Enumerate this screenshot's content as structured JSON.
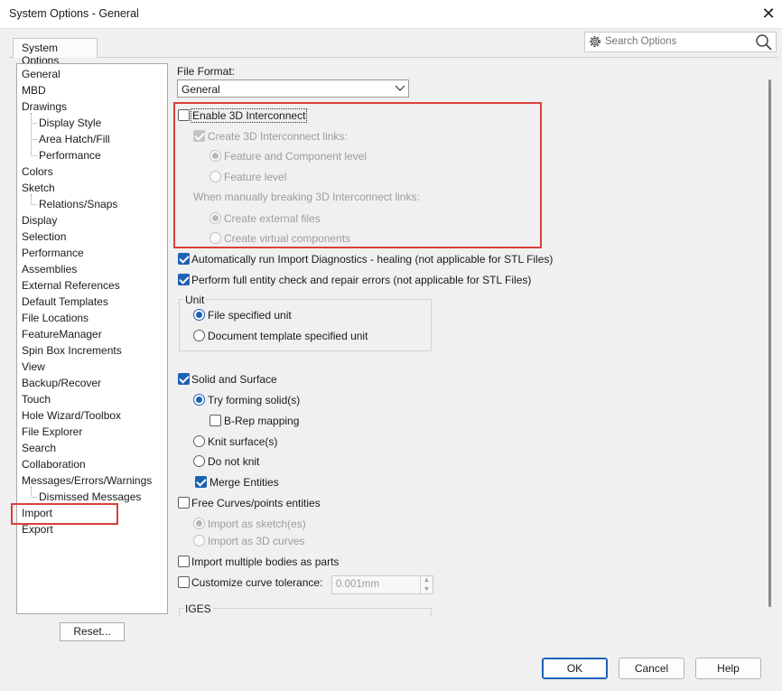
{
  "window": {
    "title": "System Options - General",
    "close_glyph": "✕"
  },
  "tab": {
    "label": "System Options"
  },
  "search": {
    "placeholder": "Search Options",
    "gear_icon": "gear-icon",
    "search_icon": "magnifier-icon"
  },
  "tree": {
    "items": [
      {
        "label": "General",
        "level": 0
      },
      {
        "label": "MBD",
        "level": 0
      },
      {
        "label": "Drawings",
        "level": 0
      },
      {
        "label": "Display Style",
        "level": 1
      },
      {
        "label": "Area Hatch/Fill",
        "level": 1
      },
      {
        "label": "Performance",
        "level": 1
      },
      {
        "label": "Colors",
        "level": 0
      },
      {
        "label": "Sketch",
        "level": 0
      },
      {
        "label": "Relations/Snaps",
        "level": 1
      },
      {
        "label": "Display",
        "level": 0
      },
      {
        "label": "Selection",
        "level": 0
      },
      {
        "label": "Performance",
        "level": 0
      },
      {
        "label": "Assemblies",
        "level": 0
      },
      {
        "label": "External References",
        "level": 0
      },
      {
        "label": "Default Templates",
        "level": 0
      },
      {
        "label": "File Locations",
        "level": 0
      },
      {
        "label": "FeatureManager",
        "level": 0
      },
      {
        "label": "Spin Box Increments",
        "level": 0
      },
      {
        "label": "View",
        "level": 0
      },
      {
        "label": "Backup/Recover",
        "level": 0
      },
      {
        "label": "Touch",
        "level": 0
      },
      {
        "label": "Hole Wizard/Toolbox",
        "level": 0
      },
      {
        "label": "File Explorer",
        "level": 0
      },
      {
        "label": "Search",
        "level": 0
      },
      {
        "label": "Collaboration",
        "level": 0
      },
      {
        "label": "Messages/Errors/Warnings",
        "level": 0
      },
      {
        "label": "Dismissed Messages",
        "level": 1
      },
      {
        "label": "Import",
        "level": 0,
        "selected": true
      },
      {
        "label": "Export",
        "level": 0
      }
    ],
    "reset_label": "Reset..."
  },
  "main": {
    "file_format_label": "File Format:",
    "file_format_value": "General",
    "enable_3d_interconnect": {
      "label": "Enable 3D Interconnect",
      "checked": false
    },
    "create_links": {
      "label": "Create 3D Interconnect links:",
      "checked": true,
      "disabled": true
    },
    "feature_component_level": {
      "label": "Feature and Component level",
      "selected": true
    },
    "feature_level": {
      "label": "Feature level",
      "selected": false
    },
    "breaking_links_label": "When manually breaking 3D Interconnect links:",
    "create_external_files": {
      "label": "Create external files",
      "selected": true
    },
    "create_virtual_components": {
      "label": "Create virtual components",
      "selected": false
    },
    "auto_import_diagnostics": {
      "label": "Automatically run Import Diagnostics - healing (not applicable for STL Files)",
      "checked": true
    },
    "full_entity_check": {
      "label": "Perform full entity check and repair errors (not applicable for STL Files)",
      "checked": true
    },
    "unit_group": {
      "title": "Unit",
      "file_specified_unit": {
        "label": "File specified unit",
        "selected": true
      },
      "document_template_unit": {
        "label": "Document template specified unit",
        "selected": false
      }
    },
    "solid_and_surface": {
      "label": "Solid and Surface",
      "checked": true
    },
    "try_forming_solids": {
      "label": "Try forming solid(s)",
      "selected": true
    },
    "brep_mapping": {
      "label": "B-Rep mapping",
      "checked": false
    },
    "knit_surfaces": {
      "label": "Knit surface(s)",
      "selected": false
    },
    "do_not_knit": {
      "label": "Do not knit",
      "selected": false
    },
    "merge_entities": {
      "label": "Merge Entities",
      "checked": true
    },
    "free_curves": {
      "label": "Free Curves/points entities",
      "checked": false
    },
    "import_as_sketch": {
      "label": "Import as sketch(es)",
      "selected": true
    },
    "import_as_3d_curves": {
      "label": "Import as 3D curves",
      "selected": false
    },
    "import_multiple_bodies": {
      "label": "Import multiple bodies as parts",
      "checked": false
    },
    "customize_curve_tolerance": {
      "label": "Customize curve tolerance:",
      "checked": false,
      "value": "0.001mm"
    },
    "iges_group_title": "IGES"
  },
  "footer": {
    "ok_label": "OK",
    "cancel_label": "Cancel",
    "help_label": "Help"
  },
  "colors": {
    "accent": "#1d62b5",
    "highlight_box": "#d9403a"
  }
}
